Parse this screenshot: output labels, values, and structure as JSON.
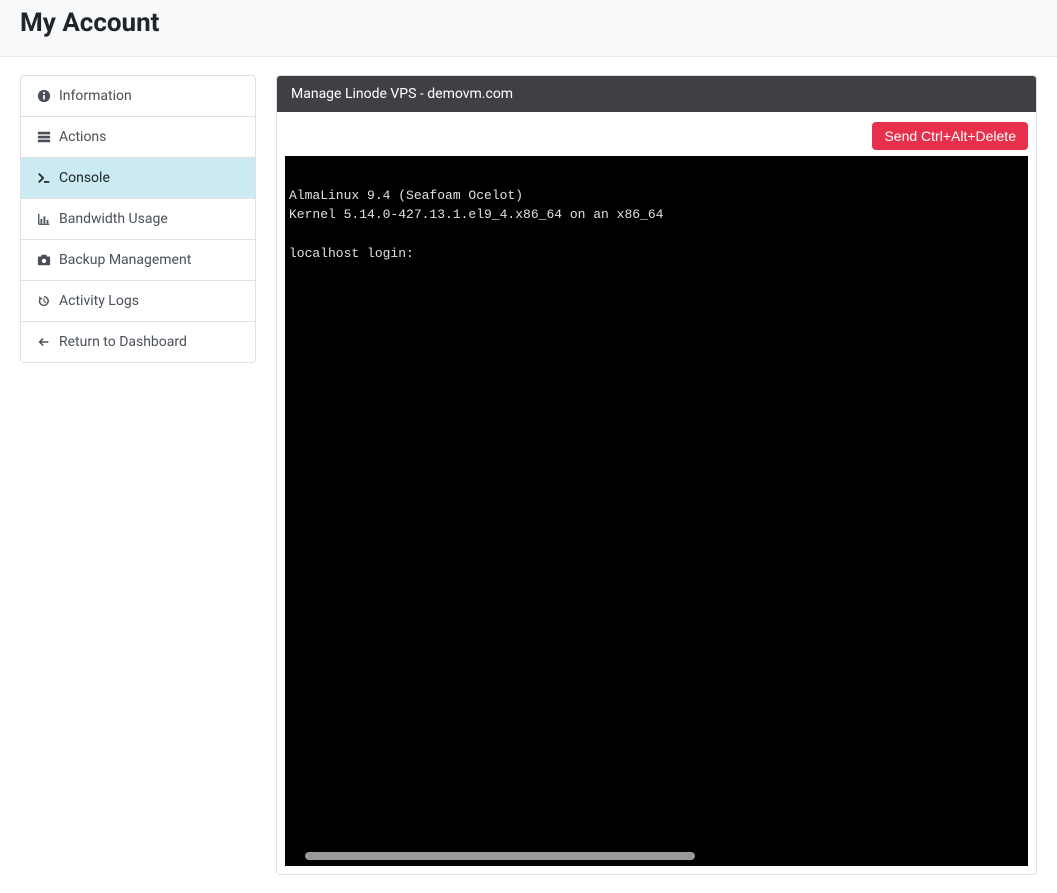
{
  "header": {
    "title": "My Account"
  },
  "sidebar": {
    "items": [
      {
        "label": "Information",
        "icon": "info-icon",
        "active": false
      },
      {
        "label": "Actions",
        "icon": "server-icon",
        "active": false
      },
      {
        "label": "Console",
        "icon": "terminal-icon",
        "active": true
      },
      {
        "label": "Bandwidth Usage",
        "icon": "chart-icon",
        "active": false
      },
      {
        "label": "Backup Management",
        "icon": "camera-icon",
        "active": false
      },
      {
        "label": "Activity Logs",
        "icon": "history-icon",
        "active": false
      },
      {
        "label": "Return to Dashboard",
        "icon": "arrow-left-icon",
        "active": false
      }
    ]
  },
  "panel": {
    "title": "Manage Linode VPS - demovm.com",
    "toolbar": {
      "ctrl_alt_delete_label": "Send Ctrl+Alt+Delete"
    },
    "console": {
      "line1": "AlmaLinux 9.4 (Seafoam Ocelot)",
      "line2": "Kernel 5.14.0-427.13.1.el9_4.x86_64 on an x86_64",
      "line3": "",
      "line4": "localhost login:"
    }
  }
}
